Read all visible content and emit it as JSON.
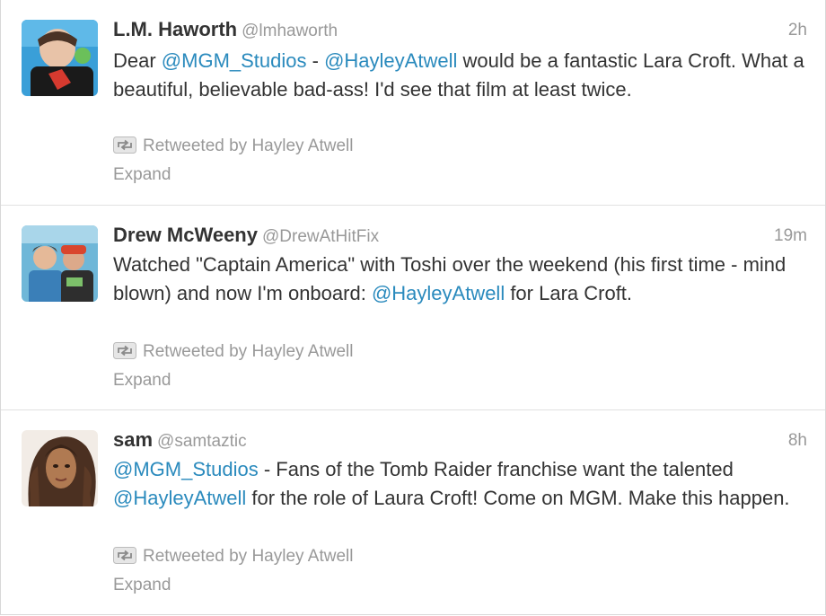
{
  "tweets": [
    {
      "fullname": "L.M. Haworth",
      "username": "@lmhaworth",
      "time": "2h",
      "text_parts": [
        "Dear ",
        "@MGM_Studios",
        " - ",
        "@HayleyAtwell",
        " would be a fantastic Lara Croft.  What a beautiful, believable bad-ass! I'd see that film at least twice."
      ],
      "retweeted_by": "Retweeted by Hayley Atwell",
      "expand": "Expand"
    },
    {
      "fullname": "Drew McWeeny",
      "username": "@DrewAtHitFix",
      "time": "19m",
      "text_parts": [
        "Watched \"Captain America\" with Toshi over the weekend (his first time - mind blown) and now I'm onboard: ",
        "@HayleyAtwell",
        " for Lara Croft."
      ],
      "retweeted_by": "Retweeted by Hayley Atwell",
      "expand": "Expand"
    },
    {
      "fullname": "sam",
      "username": "@samtaztic",
      "time": "8h",
      "text_parts": [
        "@MGM_Studios",
        " - Fans of the Tomb Raider franchise want the talented ",
        "@HayleyAtwell",
        " for the role of Laura Croft! Come on MGM. Make this happen."
      ],
      "retweeted_by": "Retweeted by Hayley Atwell",
      "expand": "Expand"
    }
  ],
  "colors": {
    "link": "#2a8abd",
    "muted": "#999999",
    "text": "#333333",
    "divider": "#e1e1e1"
  },
  "icons": {
    "retweet": "retweet-icon"
  }
}
